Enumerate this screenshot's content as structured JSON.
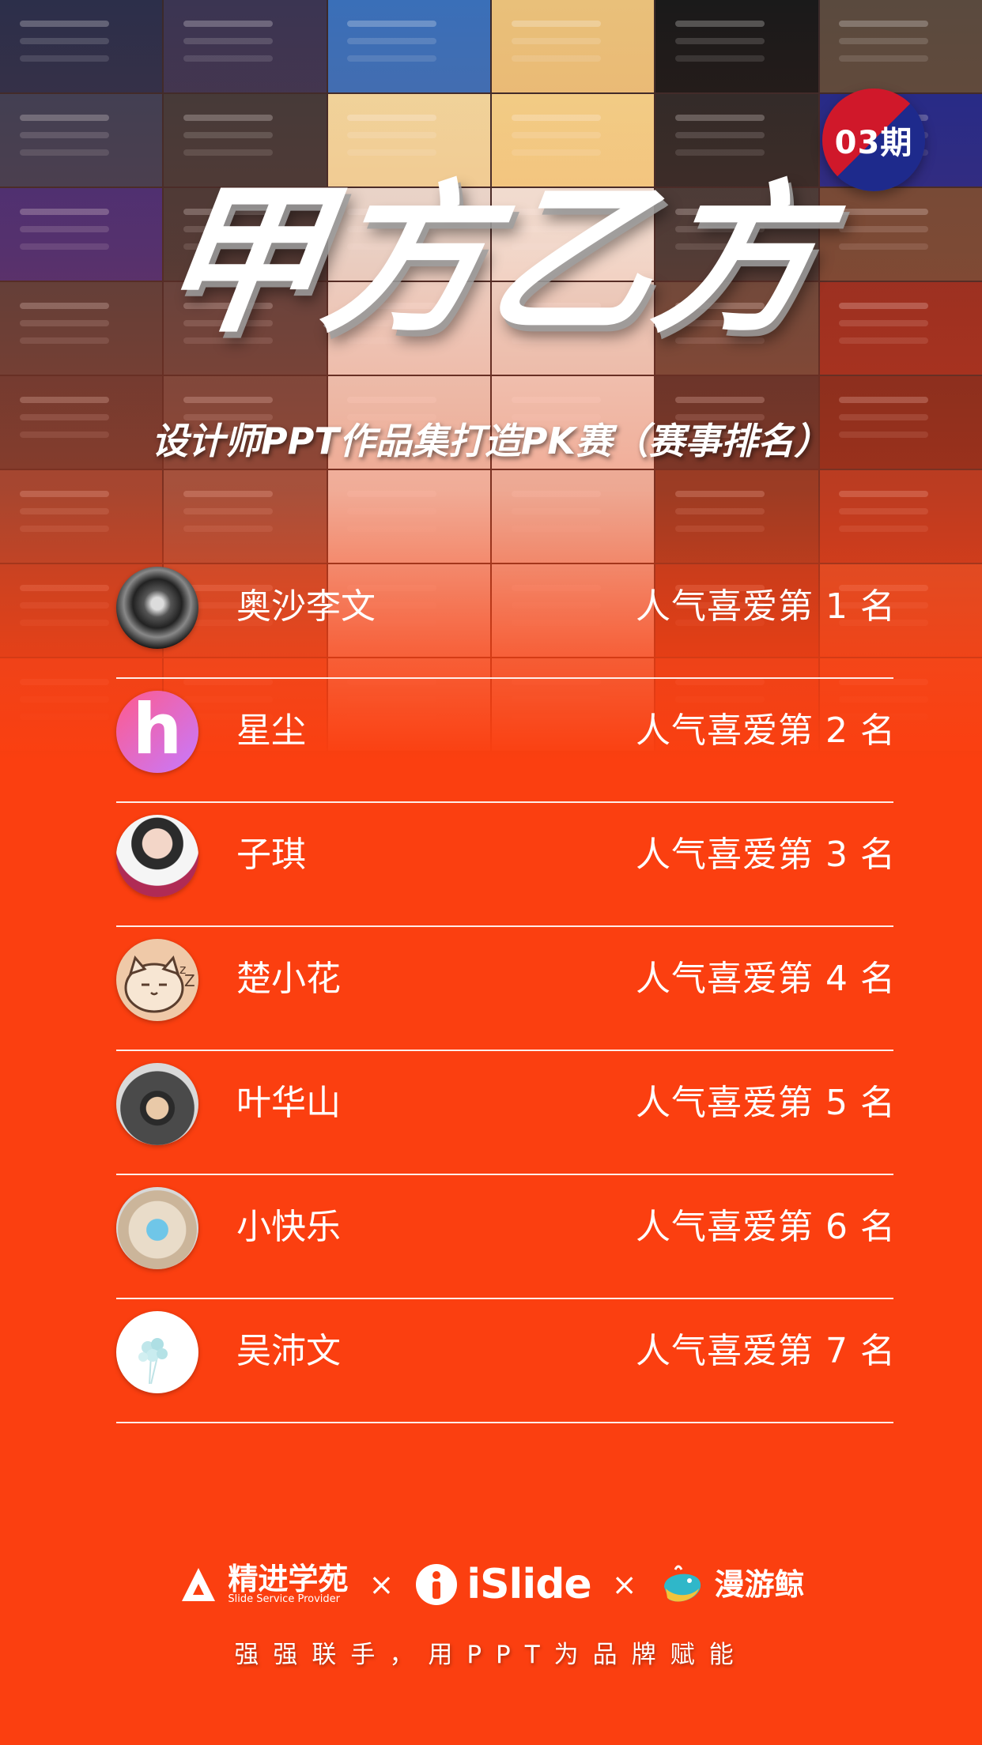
{
  "badge": {
    "issue": "03期"
  },
  "header": {
    "title": "甲方乙方",
    "subtitle": "设计师PPT作品集打造PK赛（赛事排名）"
  },
  "collage_colors": [
    "#2c2f4a",
    "#3b3552",
    "#3a6fb8",
    "#e9c07a",
    "#1a1a1a",
    "#5a4a3e",
    "#3a3f55",
    "#3e3a3a",
    "#f0d9a0",
    "#f2d28a",
    "#2a2a2a",
    "#1e2a8c",
    "#3f2f7a",
    "#3e3a3a",
    "#e7e2da",
    "#f0ebe2",
    "#3b3b3b",
    "#6b4b3a",
    "#4a3f3f",
    "#4f4444",
    "#eae4dc",
    "#e9e3da",
    "#5a4b42",
    "#8c2e24",
    "#4a3a3a",
    "#5a4a48",
    "#e8e2d9",
    "#ece6de",
    "#3f3232",
    "#6a2a22",
    "#7a4a40",
    "#7a5a52",
    "#ebe6df",
    "#e6e0d8",
    "#6a3a2e",
    "#9a3a2a",
    "#8a4638",
    "#9a5a48",
    "#e9e4de",
    "#e7e2db",
    "#8a3a2a",
    "#c05a3a",
    "#c0503a",
    "#c66448",
    "#e8dcd0",
    "#ddd4c8",
    "#b8503a",
    "#d8603a"
  ],
  "rankings": [
    {
      "name": "奥沙李文",
      "rank": "人气喜爱第 1 名",
      "avatar": "avatar-1"
    },
    {
      "name": "星尘",
      "rank": "人气喜爱第 2 名",
      "avatar": "avatar-2",
      "avatar_letter": "h"
    },
    {
      "name": "子琪",
      "rank": "人气喜爱第 3 名",
      "avatar": "avatar-3"
    },
    {
      "name": "楚小花",
      "rank": "人气喜爱第 4 名",
      "avatar": "avatar-4"
    },
    {
      "name": "叶华山",
      "rank": "人气喜爱第 5 名",
      "avatar": "avatar-5"
    },
    {
      "name": "小快乐",
      "rank": "人气喜爱第 6 名",
      "avatar": "avatar-6"
    },
    {
      "name": "吴沛文",
      "rank": "人气喜爱第 7 名",
      "avatar": "avatar-7"
    }
  ],
  "footer": {
    "brand1": {
      "name": "精进学苑",
      "tagline": "Slide Service Provider"
    },
    "times": "×",
    "brand2": {
      "name": "iSlide"
    },
    "brand3": {
      "name": "漫游鲸"
    },
    "slogan": "强强联手，用PPT为品牌赋能"
  },
  "colors": {
    "background": "#fb3f10",
    "badge_red": "#d0182a",
    "badge_blue": "#1e2a8c"
  }
}
